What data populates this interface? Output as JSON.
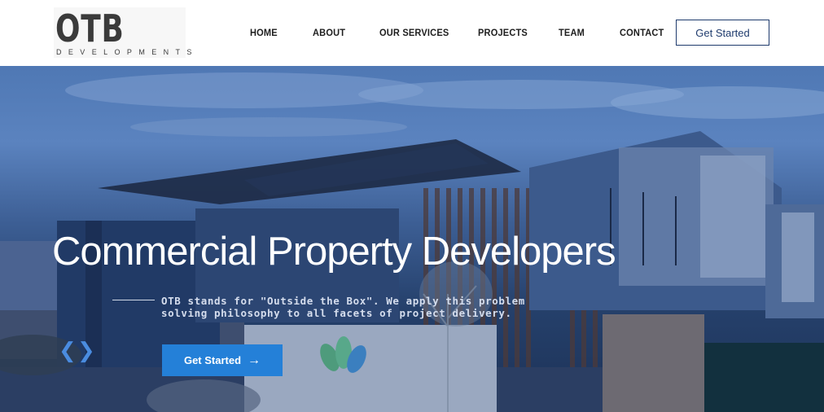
{
  "header": {
    "logo": {
      "main": "OTB",
      "sub": "DEVELOPMENTS"
    },
    "nav": [
      {
        "label": "HOME"
      },
      {
        "label": "ABOUT"
      },
      {
        "label": "OUR SERVICES"
      },
      {
        "label": "PROJECTS"
      },
      {
        "label": "TEAM"
      },
      {
        "label": "CONTACT"
      }
    ],
    "cta_label": "Get Started"
  },
  "hero": {
    "title": "Commercial Property Developers",
    "description": "OTB stands for \"Outside the Box\". We apply this problem solving philosophy to all facets of project delivery.",
    "button_label": "Get Started",
    "button_icon": "arrow-right-icon",
    "prev_arrow": "❮",
    "next_arrow": "❯"
  },
  "colors": {
    "accent": "#2480d8",
    "nav_text": "#1d1d1d",
    "brand_navy": "#1f3b6d"
  }
}
